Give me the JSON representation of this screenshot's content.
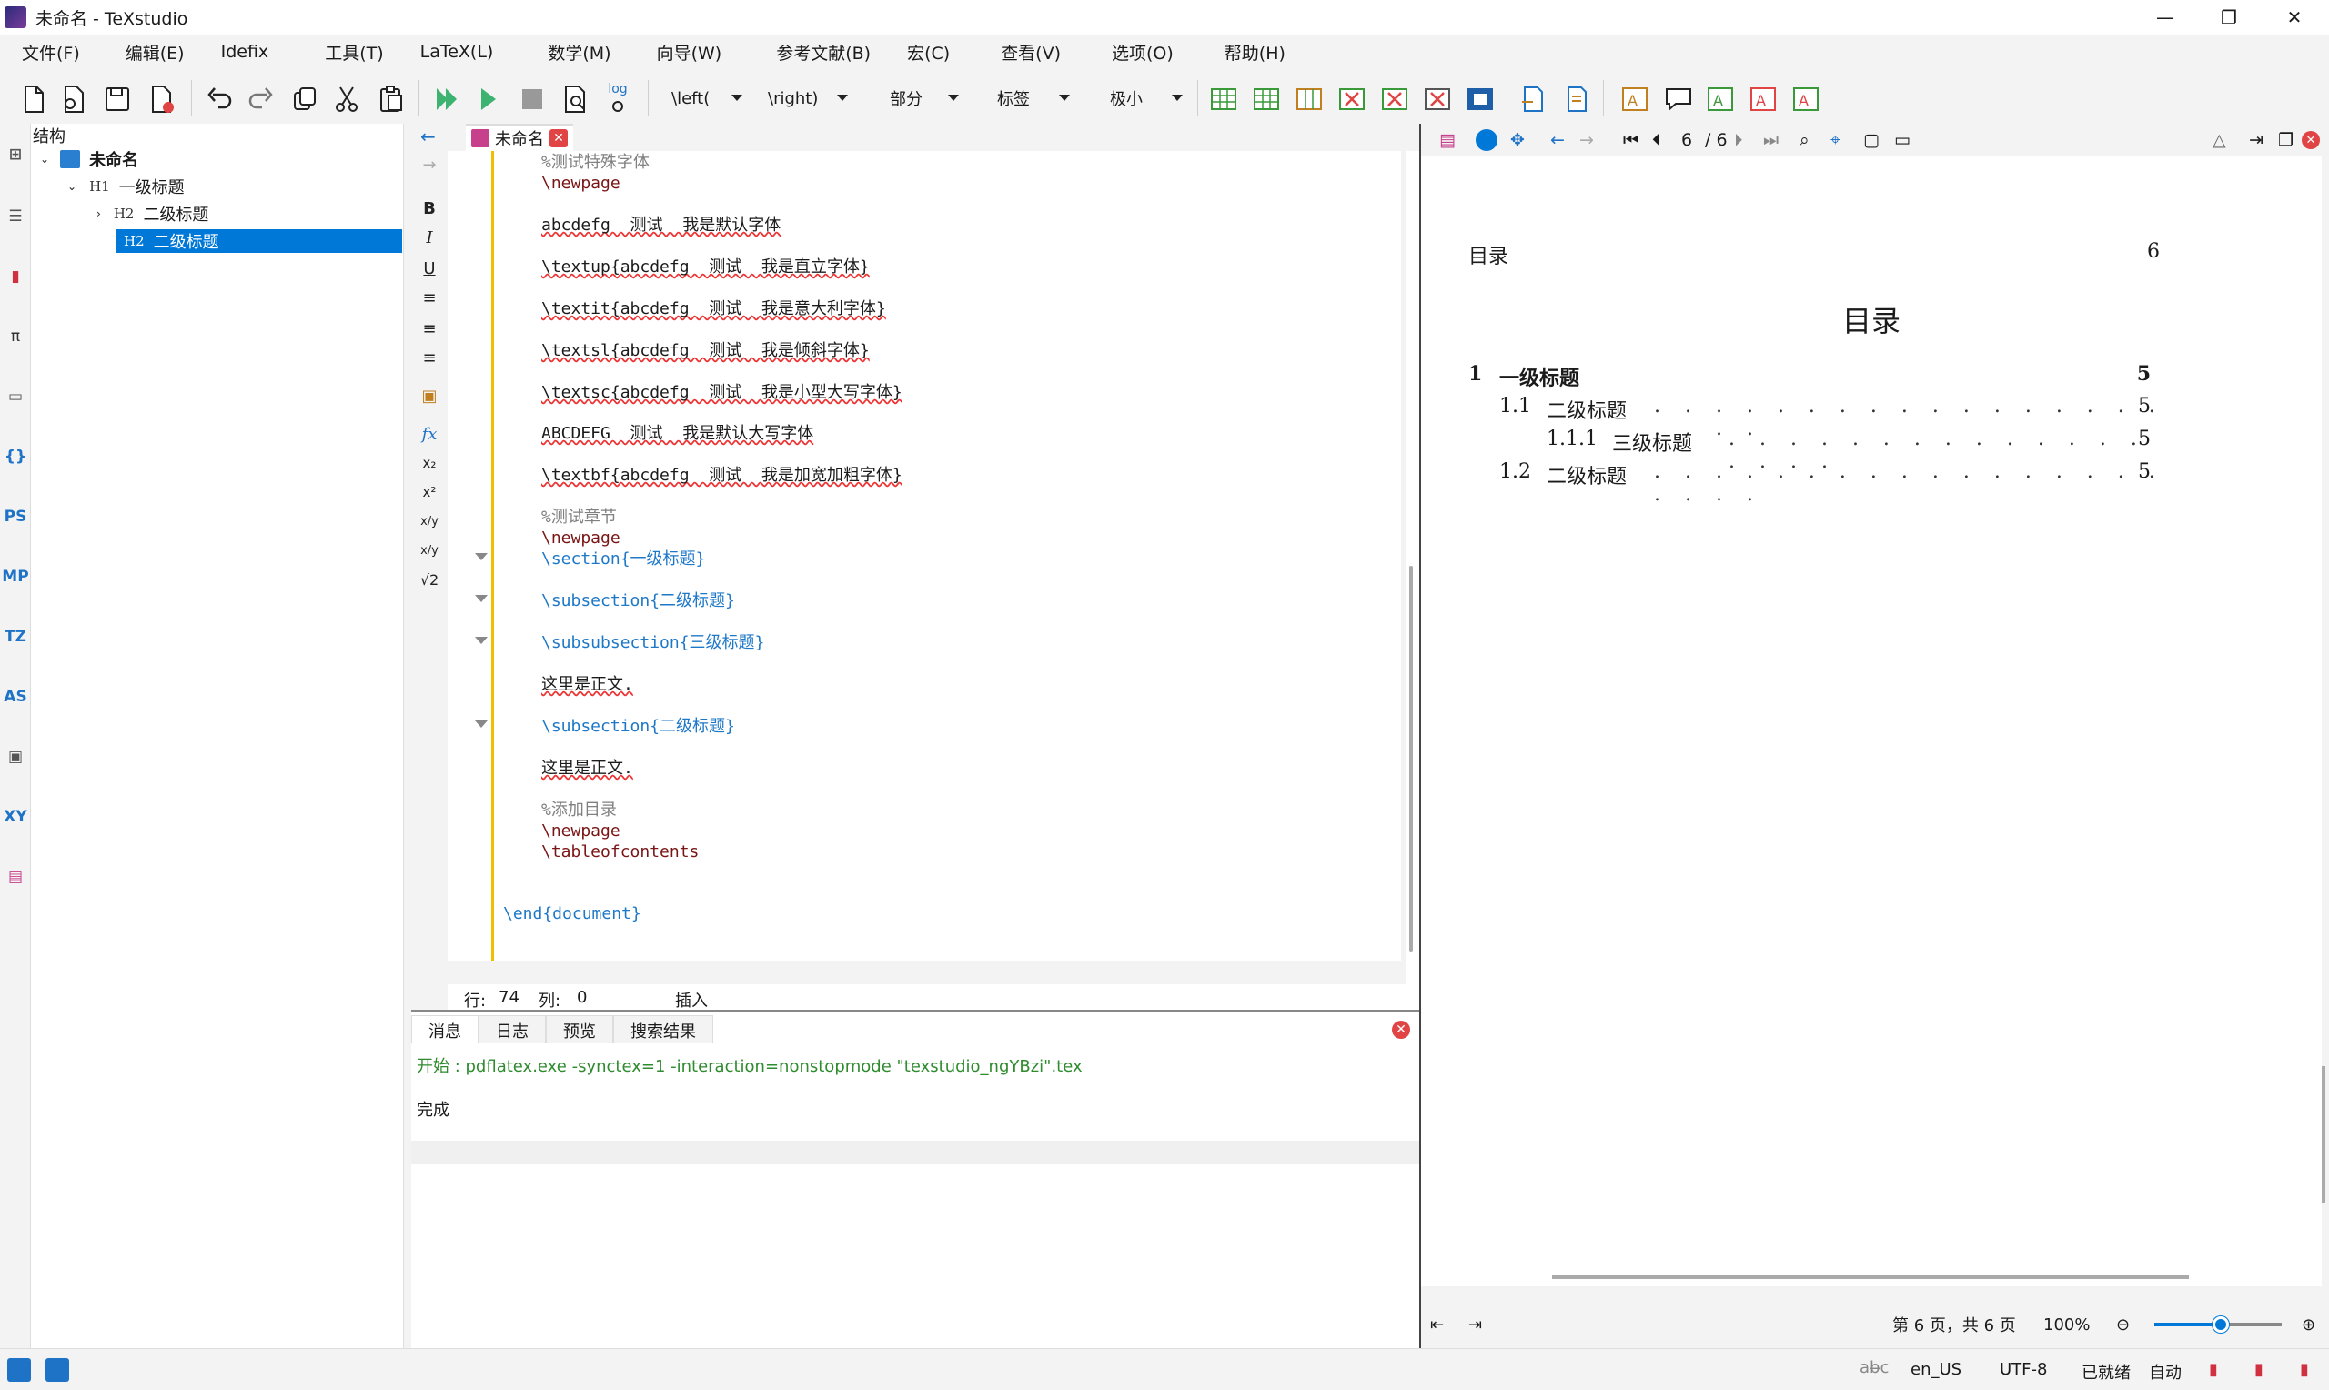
{
  "window": {
    "title": "未命名 - TeXstudio"
  },
  "menu": [
    "文件(F)",
    "编辑(E)",
    "Idefix",
    "工具(T)",
    "LaTeX(L)",
    "数学(M)",
    "向导(W)",
    "参考文献(B)",
    "宏(C)",
    "查看(V)",
    "选项(O)",
    "帮助(H)"
  ],
  "toolbar": {
    "left_label": "\\left(",
    "right_label": "\\right)",
    "part_label": "部分",
    "label_label": "标签",
    "size_label": "极小",
    "log_label": "log"
  },
  "structure": {
    "header": "结构",
    "root": "未命名",
    "items": [
      {
        "level": "H1",
        "label": "一级标题"
      },
      {
        "level": "H2",
        "label": "二级标题"
      },
      {
        "level": "H2",
        "label": "二级标题"
      }
    ]
  },
  "editor": {
    "tab": "未命名",
    "lines": [
      {
        "cls": "cmt",
        "text": "%测试特殊字体"
      },
      {
        "cls": "kw",
        "text": "\\newpage"
      },
      {
        "cls": "plain",
        "text": "abcdefg  测试  我是默认字体"
      },
      {
        "cls": "plain",
        "text": "\\textup{abcdefg  测试  我是直立字体}"
      },
      {
        "cls": "plain",
        "text": "\\textit{abcdefg  测试  我是意大利字体}"
      },
      {
        "cls": "plain",
        "text": "\\textsl{abcdefg  测试  我是倾斜字体}"
      },
      {
        "cls": "plain",
        "text": "\\textsc{abcdefg  测试  我是小型大写字体}"
      },
      {
        "cls": "plain",
        "text": "ABCDEFG  测试  我是默认大写字体"
      },
      {
        "cls": "plain",
        "text": "\\textbf{abcdefg  测试  我是加宽加粗字体}"
      },
      {
        "cls": "cmt",
        "text": "%测试章节"
      },
      {
        "cls": "kw",
        "text": "\\newpage"
      },
      {
        "cls": "sec",
        "text": "\\section{一级标题}"
      },
      {
        "cls": "sec",
        "text": "\\subsection{二级标题}"
      },
      {
        "cls": "sec",
        "text": "\\subsubsection{三级标题}"
      },
      {
        "cls": "plain",
        "text": "这里是正文."
      },
      {
        "cls": "sec",
        "text": "\\subsection{二级标题}"
      },
      {
        "cls": "plain",
        "text": "这里是正文."
      },
      {
        "cls": "cmt",
        "text": "%添加目录"
      },
      {
        "cls": "kw",
        "text": "\\newpage"
      },
      {
        "cls": "kw",
        "text": "\\tableofcontents"
      },
      {
        "cls": "sec",
        "text": "\\end{document}"
      }
    ],
    "status": {
      "line_label": "行:",
      "line": "74",
      "col_label": "列:",
      "col": "0",
      "mode": "插入"
    }
  },
  "messages": {
    "tabs": [
      "消息",
      "日志",
      "预览",
      "搜索结果"
    ],
    "start": "开始 : pdflatex.exe -synctex=1 -interaction=nonstopmode \"texstudio_ngYBzi\".tex",
    "done": "完成"
  },
  "pdf": {
    "page_current": "6",
    "page_total": "/ 6",
    "header_left": "目录",
    "header_right": "6",
    "toc_title": "目录",
    "toc": [
      {
        "num": "1",
        "title": "一级标题",
        "page": "5",
        "bold": true
      },
      {
        "num": "1.1",
        "title": "二级标题",
        "page": "5"
      },
      {
        "num": "1.1.1",
        "title": "三级标题",
        "page": "5"
      },
      {
        "num": "1.2",
        "title": "二级标题",
        "page": "5"
      }
    ],
    "status_pages": "第 6 页，共 6 页",
    "zoom": "100%"
  },
  "statusbar": {
    "lang": "en_US",
    "encoding": "UTF-8",
    "ready": "已就绪",
    "auto": "自动"
  },
  "colors": {
    "accent": "#0078d7",
    "comment": "#808080",
    "keyword": "#7a1515",
    "section": "#1e78c8"
  }
}
